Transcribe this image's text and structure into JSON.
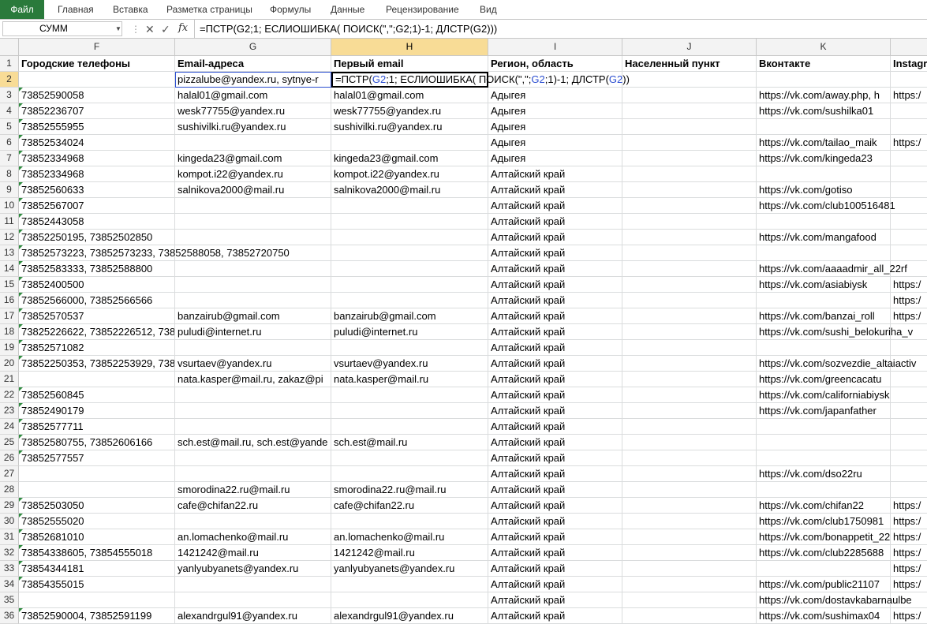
{
  "ribbon": {
    "tabs": [
      "Файл",
      "Главная",
      "Вставка",
      "Разметка страницы",
      "Формулы",
      "Данные",
      "Рецензирование",
      "Вид"
    ]
  },
  "formula_bar": {
    "name_box": "СУММ",
    "formula": "=ПСТР(G2;1; ЕСЛИОШИБКА( ПОИСК(\",\";G2;1)-1; ДЛСТР(G2)))"
  },
  "columns": [
    {
      "letter": "F"
    },
    {
      "letter": "G"
    },
    {
      "letter": "H"
    },
    {
      "letter": "I"
    },
    {
      "letter": "J"
    },
    {
      "letter": "K"
    },
    {
      "letter": ""
    }
  ],
  "selected_column": "H",
  "header_row": [
    "Городские телефоны",
    "Email-адреса",
    "Первый email",
    "Регион, область",
    "Населенный пункт",
    "Вконтакте",
    "Instagr"
  ],
  "active_cell_text": {
    "part1": "=ПСТР(",
    "ref1": "G2",
    "part2": ";1; ЕСЛИОШИБКА( ПОИСК(\",\";",
    "ref2": "G2",
    "part3": ";1)-1; ДЛСТР(",
    "ref3": "G2",
    "part4": "))"
  },
  "row2_email": "pizzalube@yandex.ru, sytnye-r",
  "rows": [
    {
      "n": "3",
      "f": "73852590058",
      "g": "halal01@gmail.com",
      "h": "halal01@gmail.com",
      "i": "Адыгея",
      "k": "https://vk.com/away.php, h",
      "l": "https:/"
    },
    {
      "n": "4",
      "f": "73852236707",
      "g": "wesk77755@yandex.ru",
      "h": "wesk77755@yandex.ru",
      "i": "Адыгея",
      "k": "https://vk.com/sushilka01",
      "l": ""
    },
    {
      "n": "5",
      "f": "73852555955",
      "g": "sushivilki.ru@yandex.ru",
      "h": "sushivilki.ru@yandex.ru",
      "i": "Адыгея",
      "k": "",
      "l": ""
    },
    {
      "n": "6",
      "f": "73852534024",
      "g": "",
      "h": "",
      "i": "Адыгея",
      "k": "https://vk.com/tailao_maik",
      "l": "https:/"
    },
    {
      "n": "7",
      "f": "73852334968",
      "g": "kingeda23@gmail.com",
      "h": "kingeda23@gmail.com",
      "i": "Адыгея",
      "k": "https://vk.com/kingeda23",
      "l": ""
    },
    {
      "n": "8",
      "f": "73852334968",
      "g": "kompot.i22@yandex.ru",
      "h": "kompot.i22@yandex.ru",
      "i": "Алтайский край",
      "k": "",
      "l": ""
    },
    {
      "n": "9",
      "f": "73852560633",
      "g": "salnikova2000@mail.ru",
      "h": "salnikova2000@mail.ru",
      "i": "Алтайский край",
      "k": "https://vk.com/gotiso",
      "l": ""
    },
    {
      "n": "10",
      "f": "73852567007",
      "g": "",
      "h": "",
      "i": "Алтайский край",
      "k": "https://vk.com/club100516481",
      "l": ""
    },
    {
      "n": "11",
      "f": "73852443058",
      "g": "",
      "h": "",
      "i": "Алтайский край",
      "k": "",
      "l": ""
    },
    {
      "n": "12",
      "f": "73852250195, 73852502850",
      "g": "",
      "h": "",
      "i": "Алтайский край",
      "k": "https://vk.com/mangafood",
      "l": ""
    },
    {
      "n": "13",
      "f": "73852573223, 73852573233, 73852588058, 73852720750",
      "g": "",
      "h": "",
      "i": "Алтайский край",
      "k": "",
      "l": ""
    },
    {
      "n": "14",
      "f": "73852583333, 73852588800",
      "g": "",
      "h": "",
      "i": "Алтайский край",
      "k": "https://vk.com/aaaadmir_all_22rf",
      "l": ""
    },
    {
      "n": "15",
      "f": "73852400500",
      "g": "",
      "h": "",
      "i": "Алтайский край",
      "k": "https://vk.com/asiabiysk",
      "l": "https:/"
    },
    {
      "n": "16",
      "f": "73852566000, 73852566566",
      "g": "",
      "h": "",
      "i": "Алтайский край",
      "k": "",
      "l": "https:/"
    },
    {
      "n": "17",
      "f": "73852570537",
      "g": "banzairub@gmail.com",
      "h": "banzairub@gmail.com",
      "i": "Алтайский край",
      "k": "https://vk.com/banzai_roll",
      "l": "https:/"
    },
    {
      "n": "18",
      "f": "73825226622, 73852226512, 7385",
      "g": "puludi@internet.ru",
      "h": "puludi@internet.ru",
      "i": "Алтайский край",
      "k": "https://vk.com/sushi_belokuriha_v",
      "l": ""
    },
    {
      "n": "19",
      "f": "73852571082",
      "g": "",
      "h": "",
      "i": "Алтайский край",
      "k": "",
      "l": ""
    },
    {
      "n": "20",
      "f": "73852250353, 73852253929, 7385",
      "g": "vsurtaev@yandex.ru",
      "h": "vsurtaev@yandex.ru",
      "i": "Алтайский край",
      "k": "https://vk.com/sozvezdie_altaiactiv",
      "l": ""
    },
    {
      "n": "21",
      "f": "",
      "g": "nata.kasper@mail.ru, zakaz@pi",
      "h": "nata.kasper@mail.ru",
      "i": "Алтайский край",
      "k": "https://vk.com/greencacatu",
      "l": ""
    },
    {
      "n": "22",
      "f": "73852560845",
      "g": "",
      "h": "",
      "i": "Алтайский край",
      "k": "https://vk.com/californiabiysk",
      "l": ""
    },
    {
      "n": "23",
      "f": "73852490179",
      "g": "",
      "h": "",
      "i": "Алтайский край",
      "k": "https://vk.com/japanfather",
      "l": ""
    },
    {
      "n": "24",
      "f": "73852577711",
      "g": "",
      "h": "",
      "i": "Алтайский край",
      "k": "",
      "l": ""
    },
    {
      "n": "25",
      "f": "73852580755, 73852606166",
      "g": "sch.est@mail.ru, sch.est@yande",
      "h": "sch.est@mail.ru",
      "i": "Алтайский край",
      "k": "",
      "l": ""
    },
    {
      "n": "26",
      "f": "73852577557",
      "g": "",
      "h": "",
      "i": "Алтайский край",
      "k": "",
      "l": ""
    },
    {
      "n": "27",
      "f": "",
      "g": "",
      "h": "",
      "i": "Алтайский край",
      "k": "https://vk.com/dso22ru",
      "l": ""
    },
    {
      "n": "28",
      "f": "",
      "g": "smorodina22.ru@mail.ru",
      "h": "smorodina22.ru@mail.ru",
      "i": "Алтайский край",
      "k": "",
      "l": ""
    },
    {
      "n": "29",
      "f": "73852503050",
      "g": "cafe@chifan22.ru",
      "h": "cafe@chifan22.ru",
      "i": "Алтайский край",
      "k": "https://vk.com/chifan22",
      "l": "https:/"
    },
    {
      "n": "30",
      "f": "73852555020",
      "g": "",
      "h": "",
      "i": "Алтайский край",
      "k": "https://vk.com/club1750981",
      "l": "https:/"
    },
    {
      "n": "31",
      "f": "73852681010",
      "g": "an.lomachenko@mail.ru",
      "h": "an.lomachenko@mail.ru",
      "i": "Алтайский край",
      "k": "https://vk.com/bonappetit_22",
      "l": "https:/"
    },
    {
      "n": "32",
      "f": "73854338605, 73854555018",
      "g": "1421242@mail.ru",
      "h": "1421242@mail.ru",
      "i": "Алтайский край",
      "k": "https://vk.com/club2285688",
      "l": "https:/"
    },
    {
      "n": "33",
      "f": "73854344181",
      "g": "yanlyubyanets@yandex.ru",
      "h": "yanlyubyanets@yandex.ru",
      "i": "Алтайский край",
      "k": "",
      "l": "https:/"
    },
    {
      "n": "34",
      "f": "73854355015",
      "g": "",
      "h": "",
      "i": "Алтайский край",
      "k": "https://vk.com/public21107",
      "l": "https:/"
    },
    {
      "n": "35",
      "f": "",
      "g": "",
      "h": "",
      "i": "Алтайский край",
      "k": "https://vk.com/dostavkabarnaulbe",
      "l": ""
    },
    {
      "n": "36",
      "f": "73852590004, 73852591199",
      "g": "alexandrgul91@yandex.ru",
      "h": "alexandrgul91@yandex.ru",
      "i": "Алтайский край",
      "k": "https://vk.com/sushimax04",
      "l": "https:/"
    }
  ]
}
